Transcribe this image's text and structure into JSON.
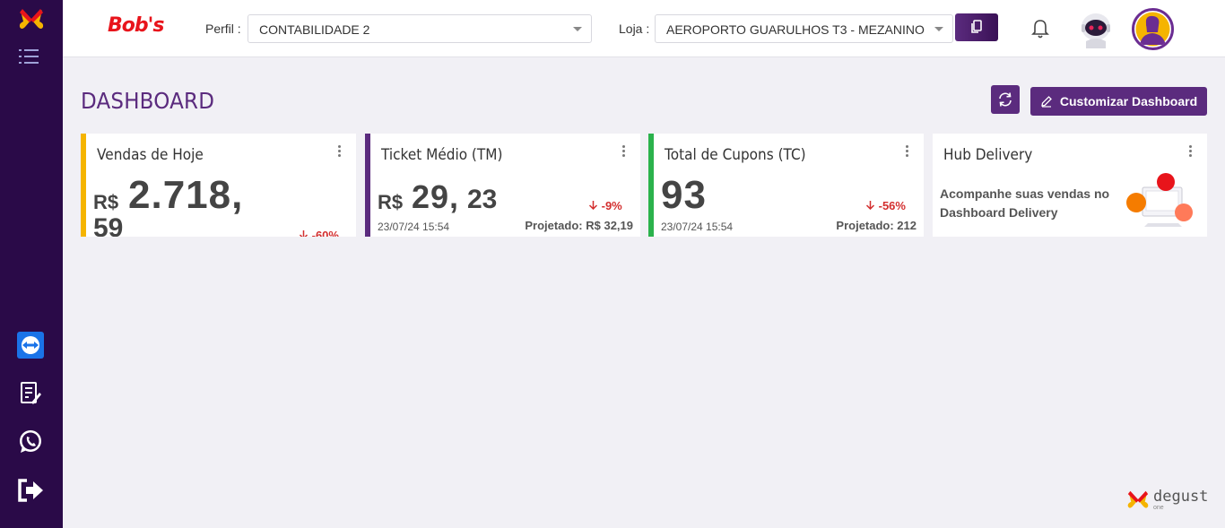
{
  "header": {
    "brand": "Bob's",
    "perfil_label": "Perfil :",
    "perfil_value": "CONTABILIDADE 2",
    "loja_label": "Loja :",
    "loja_value": "AEROPORTO GUARULHOS T3 - MEZANINO"
  },
  "page": {
    "title": "DASHBOARD",
    "customize_label": "Customizar Dashboard"
  },
  "cards": [
    {
      "title": "Vendas de Hoje",
      "currency": "R$",
      "value_int": "2.718,",
      "value_dec": "59",
      "change": "-60%",
      "accent": "#f5b400"
    },
    {
      "title": "Ticket Médio (TM)",
      "currency": "R$",
      "value_int": "29,",
      "value_dec": "23",
      "change": "-9%",
      "date": "23/07/24 15:54",
      "projected": "Projetado: R$ 32,19",
      "accent": "#5b2b7e"
    },
    {
      "title": "Total de Cupons (TC)",
      "value_int": "93",
      "change": "-56%",
      "date": "23/07/24 15:54",
      "projected": "Projetado: 212",
      "accent": "#2bb24c"
    },
    {
      "title": "Hub Delivery",
      "description": "Acompanhe suas vendas no Dashboard Delivery"
    }
  ],
  "footer": {
    "brand": "degust",
    "sub": "one"
  },
  "colors": {
    "sidebar": "#2a0a48",
    "primary": "#5b2b7e",
    "negative": "#d32f2f"
  },
  "icons": [
    "app-logo-icon",
    "menu-icon",
    "teamviewer-icon",
    "report-icon",
    "whatsapp-icon",
    "logout-icon",
    "bell-icon",
    "copy-icon",
    "refresh-icon",
    "pencil-icon",
    "kebab-icon",
    "arrow-down-icon"
  ]
}
